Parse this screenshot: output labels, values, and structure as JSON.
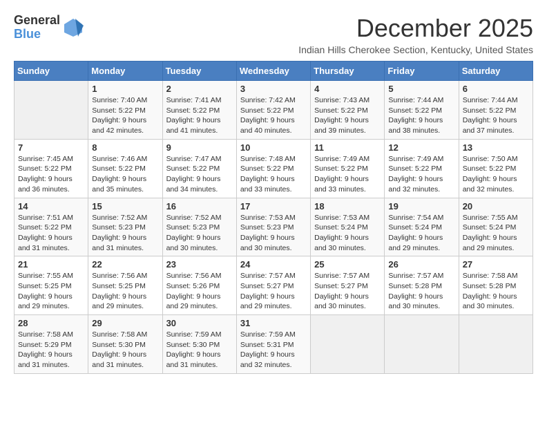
{
  "logo": {
    "line1": "General",
    "line2": "Blue"
  },
  "title": "December 2025",
  "subtitle": "Indian Hills Cherokee Section, Kentucky, United States",
  "days_of_week": [
    "Sunday",
    "Monday",
    "Tuesday",
    "Wednesday",
    "Thursday",
    "Friday",
    "Saturday"
  ],
  "weeks": [
    [
      {
        "day": "",
        "empty": true
      },
      {
        "day": "1",
        "sunrise": "7:40 AM",
        "sunset": "5:22 PM",
        "daylight": "9 hours and 42 minutes."
      },
      {
        "day": "2",
        "sunrise": "7:41 AM",
        "sunset": "5:22 PM",
        "daylight": "9 hours and 41 minutes."
      },
      {
        "day": "3",
        "sunrise": "7:42 AM",
        "sunset": "5:22 PM",
        "daylight": "9 hours and 40 minutes."
      },
      {
        "day": "4",
        "sunrise": "7:43 AM",
        "sunset": "5:22 PM",
        "daylight": "9 hours and 39 minutes."
      },
      {
        "day": "5",
        "sunrise": "7:44 AM",
        "sunset": "5:22 PM",
        "daylight": "9 hours and 38 minutes."
      },
      {
        "day": "6",
        "sunrise": "7:44 AM",
        "sunset": "5:22 PM",
        "daylight": "9 hours and 37 minutes."
      }
    ],
    [
      {
        "day": "7",
        "sunrise": "7:45 AM",
        "sunset": "5:22 PM",
        "daylight": "9 hours and 36 minutes."
      },
      {
        "day": "8",
        "sunrise": "7:46 AM",
        "sunset": "5:22 PM",
        "daylight": "9 hours and 35 minutes."
      },
      {
        "day": "9",
        "sunrise": "7:47 AM",
        "sunset": "5:22 PM",
        "daylight": "9 hours and 34 minutes."
      },
      {
        "day": "10",
        "sunrise": "7:48 AM",
        "sunset": "5:22 PM",
        "daylight": "9 hours and 33 minutes."
      },
      {
        "day": "11",
        "sunrise": "7:49 AM",
        "sunset": "5:22 PM",
        "daylight": "9 hours and 33 minutes."
      },
      {
        "day": "12",
        "sunrise": "7:49 AM",
        "sunset": "5:22 PM",
        "daylight": "9 hours and 32 minutes."
      },
      {
        "day": "13",
        "sunrise": "7:50 AM",
        "sunset": "5:22 PM",
        "daylight": "9 hours and 32 minutes."
      }
    ],
    [
      {
        "day": "14",
        "sunrise": "7:51 AM",
        "sunset": "5:22 PM",
        "daylight": "9 hours and 31 minutes."
      },
      {
        "day": "15",
        "sunrise": "7:52 AM",
        "sunset": "5:23 PM",
        "daylight": "9 hours and 31 minutes."
      },
      {
        "day": "16",
        "sunrise": "7:52 AM",
        "sunset": "5:23 PM",
        "daylight": "9 hours and 30 minutes."
      },
      {
        "day": "17",
        "sunrise": "7:53 AM",
        "sunset": "5:23 PM",
        "daylight": "9 hours and 30 minutes."
      },
      {
        "day": "18",
        "sunrise": "7:53 AM",
        "sunset": "5:24 PM",
        "daylight": "9 hours and 30 minutes."
      },
      {
        "day": "19",
        "sunrise": "7:54 AM",
        "sunset": "5:24 PM",
        "daylight": "9 hours and 29 minutes."
      },
      {
        "day": "20",
        "sunrise": "7:55 AM",
        "sunset": "5:24 PM",
        "daylight": "9 hours and 29 minutes."
      }
    ],
    [
      {
        "day": "21",
        "sunrise": "7:55 AM",
        "sunset": "5:25 PM",
        "daylight": "9 hours and 29 minutes."
      },
      {
        "day": "22",
        "sunrise": "7:56 AM",
        "sunset": "5:25 PM",
        "daylight": "9 hours and 29 minutes."
      },
      {
        "day": "23",
        "sunrise": "7:56 AM",
        "sunset": "5:26 PM",
        "daylight": "9 hours and 29 minutes."
      },
      {
        "day": "24",
        "sunrise": "7:57 AM",
        "sunset": "5:27 PM",
        "daylight": "9 hours and 29 minutes."
      },
      {
        "day": "25",
        "sunrise": "7:57 AM",
        "sunset": "5:27 PM",
        "daylight": "9 hours and 30 minutes."
      },
      {
        "day": "26",
        "sunrise": "7:57 AM",
        "sunset": "5:28 PM",
        "daylight": "9 hours and 30 minutes."
      },
      {
        "day": "27",
        "sunrise": "7:58 AM",
        "sunset": "5:28 PM",
        "daylight": "9 hours and 30 minutes."
      }
    ],
    [
      {
        "day": "28",
        "sunrise": "7:58 AM",
        "sunset": "5:29 PM",
        "daylight": "9 hours and 31 minutes."
      },
      {
        "day": "29",
        "sunrise": "7:58 AM",
        "sunset": "5:30 PM",
        "daylight": "9 hours and 31 minutes."
      },
      {
        "day": "30",
        "sunrise": "7:59 AM",
        "sunset": "5:30 PM",
        "daylight": "9 hours and 31 minutes."
      },
      {
        "day": "31",
        "sunrise": "7:59 AM",
        "sunset": "5:31 PM",
        "daylight": "9 hours and 32 minutes."
      },
      {
        "day": "",
        "empty": true
      },
      {
        "day": "",
        "empty": true
      },
      {
        "day": "",
        "empty": true
      }
    ]
  ]
}
